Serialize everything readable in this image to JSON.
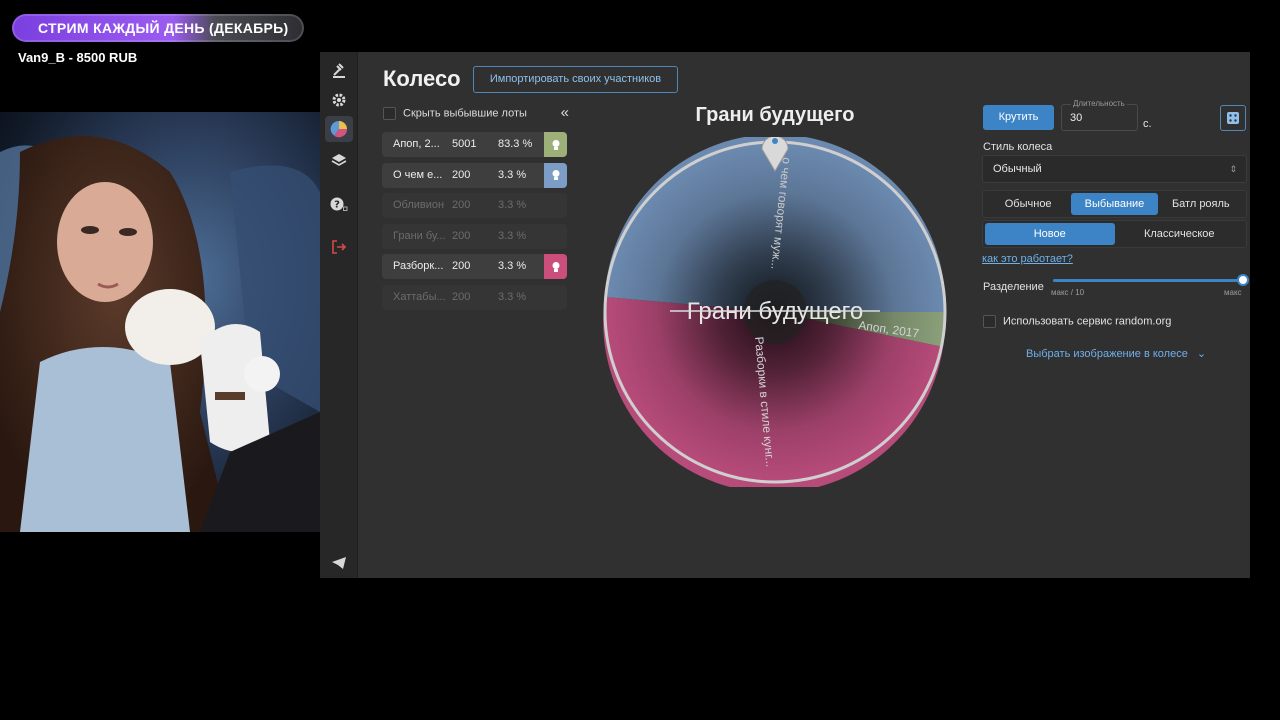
{
  "overlay": {
    "banner": "СТРИМ КАЖДЫЙ ДЕНЬ (ДЕКАБРЬ)",
    "donation": "Van9_B - 8500 RUB"
  },
  "app": {
    "title": "Колесо",
    "import_button": "Импортировать своих участников",
    "hide_label": "Скрыть выбывшие лоты",
    "collapse_icon": "«",
    "lots": [
      {
        "name": "Апоп, 2...",
        "amount": "5001",
        "percent": "83.3 %",
        "color": "#9db07a",
        "out": false
      },
      {
        "name": "О чем е...",
        "amount": "200",
        "percent": "3.3 %",
        "color": "#7c9dc6",
        "out": false
      },
      {
        "name": "Обливион",
        "amount": "200",
        "percent": "3.3 %",
        "color": "",
        "out": true
      },
      {
        "name": "Грани бу...",
        "amount": "200",
        "percent": "3.3 %",
        "color": "",
        "out": true
      },
      {
        "name": "Разборк...",
        "amount": "200",
        "percent": "3.3 %",
        "color": "#cc4f7b",
        "out": false
      },
      {
        "name": "Хаттабы...",
        "amount": "200",
        "percent": "3.3 %",
        "color": "",
        "out": true
      }
    ],
    "wheel_title": "Грани будущего",
    "wheel_center": "Грани будущего",
    "wheel_sector_texts": {
      "blue": "о чем говорят муж...",
      "green": "Апоп, 2017",
      "pink": "Разборки в стиле кунг..."
    },
    "wheel_colors": {
      "blue": "#6c8ab0",
      "green": "#8aa07a",
      "pink": "#b74b7a"
    },
    "spin_button": "Крутить",
    "duration_label": "Длительность",
    "duration_value": "30",
    "duration_unit": "с.",
    "style_label": "Стиль колеса",
    "style_value": "Обычный",
    "mode_tabs": [
      "Обычное",
      "Выбывание",
      "Батл рояль"
    ],
    "mode_selected": "Выбывание",
    "variant_tabs": [
      "Новое",
      "Классическое"
    ],
    "variant_selected": "Новое",
    "how_link": "как это работает?",
    "split_label": "Разделение",
    "split_min": "макс / 10",
    "split_max": "макс",
    "random_org": "Использовать сервис random.org",
    "select_image": "Выбрать изображение в колесе"
  }
}
